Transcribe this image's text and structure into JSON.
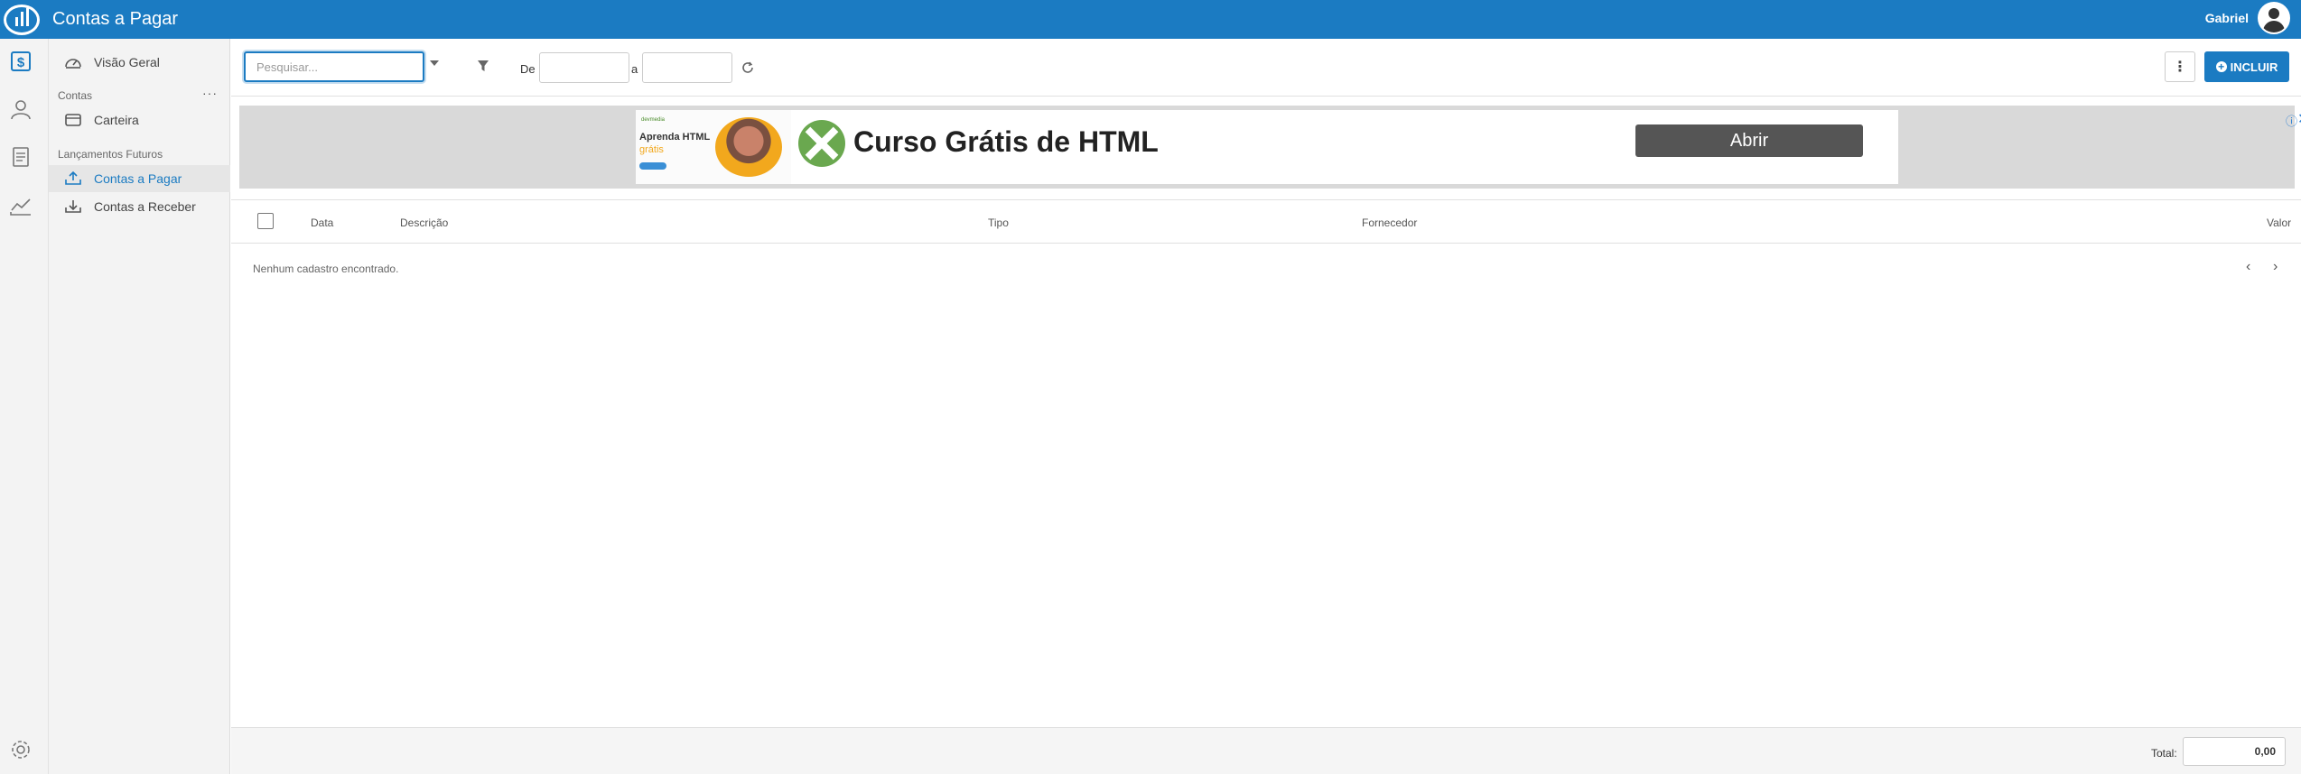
{
  "header": {
    "title": "Contas a Pagar",
    "user_name": "Gabriel"
  },
  "rail": {
    "icons": [
      "dollar-icon",
      "user-icon",
      "document-icon",
      "chart-icon",
      "settings-icon"
    ]
  },
  "sidebar": {
    "overview": "Visão Geral",
    "section_accounts": "Contas",
    "more": "···",
    "wallet": "Carteira",
    "section_future": "Lançamentos Futuros",
    "payables": "Contas a Pagar",
    "receivables": "Contas a Receber"
  },
  "toolbar": {
    "search_placeholder": "Pesquisar...",
    "from_label": "De",
    "to_label": "a",
    "more_label": "⋮",
    "add_label": "INCLUIR"
  },
  "ad": {
    "thumb_brand": "devmedia",
    "thumb_line1": "Aprenda HTML",
    "thumb_line2": "grátis",
    "headline": "Curso Grátis de HTML",
    "cta": "Abrir",
    "info": "ⓘ",
    "close": "✕"
  },
  "table": {
    "columns": {
      "date": "Data",
      "description": "Descrição",
      "type": "Tipo",
      "supplier": "Fornecedor",
      "value": "Valor"
    },
    "empty_message": "Nenhum cadastro encontrado.",
    "prev": "‹",
    "next": "›"
  },
  "footer": {
    "total_label": "Total:",
    "total_value": "0,00"
  },
  "colors": {
    "primary": "#1b7bc2",
    "sidebar_bg": "#f3f3f3"
  }
}
